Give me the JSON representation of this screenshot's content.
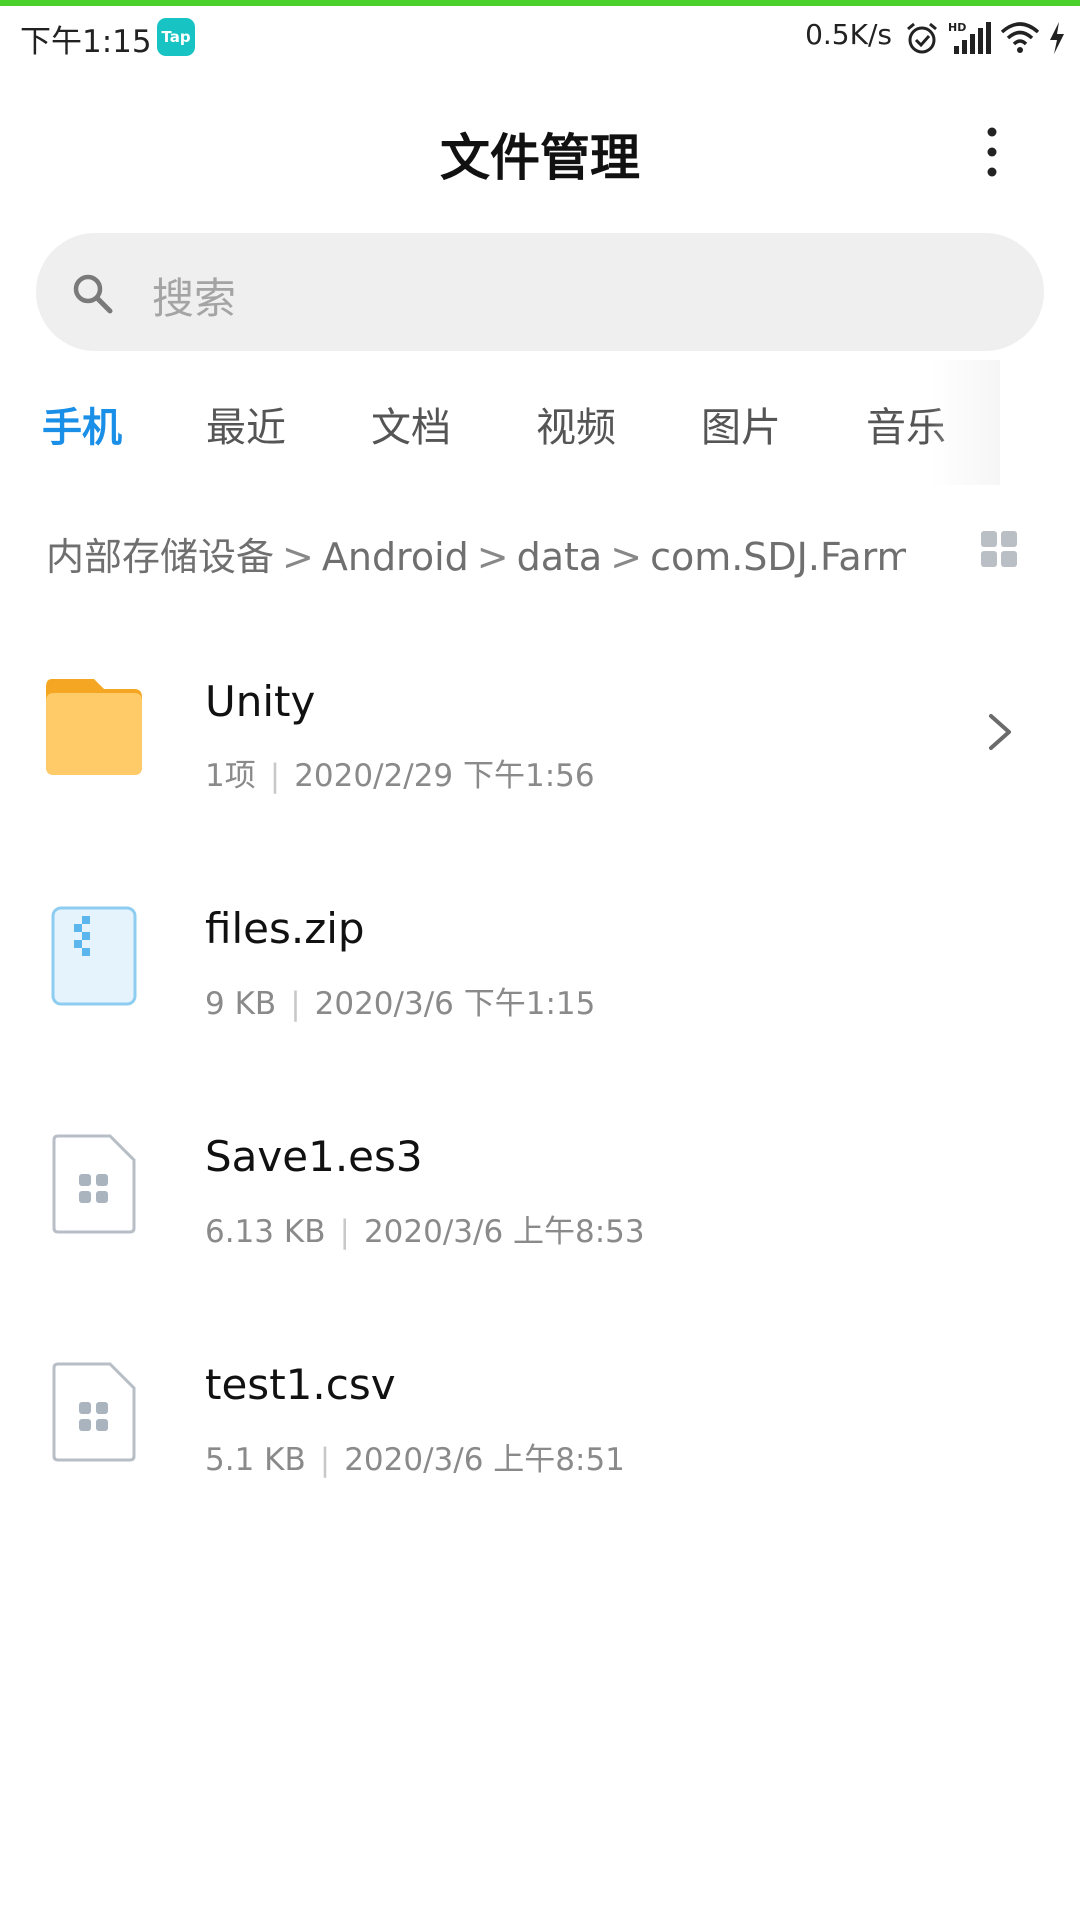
{
  "status_bar": {
    "time": "下午1:15",
    "app_badge": "Tap",
    "network_speed": "0.5K/s",
    "icons": [
      "alarm-icon",
      "hd-signal-icon",
      "wifi-icon",
      "charging-icon"
    ]
  },
  "header": {
    "title": "文件管理",
    "more_icon": "more-vertical-icon"
  },
  "search": {
    "placeholder": "搜索",
    "icon": "search-icon"
  },
  "tabs": [
    {
      "label": "手机",
      "active": true
    },
    {
      "label": "最近",
      "active": false
    },
    {
      "label": "文档",
      "active": false
    },
    {
      "label": "视频",
      "active": false
    },
    {
      "label": "图片",
      "active": false
    },
    {
      "label": "音乐",
      "active": false
    }
  ],
  "breadcrumb": [
    "内部存储设备",
    "Android",
    "data",
    "com.SDJ.Farm"
  ],
  "view_toggle_icon": "grid-view-icon",
  "files": [
    {
      "name": "Unity",
      "size": "1项",
      "date": "2020/2/29 下午1:56",
      "type": "folder",
      "icon": "folder-icon"
    },
    {
      "name": "files.zip",
      "size": "9 KB",
      "date": "2020/3/6 下午1:15",
      "type": "zip",
      "icon": "zip-file-icon"
    },
    {
      "name": "Save1.es3",
      "size": "6.13 KB",
      "date": "2020/3/6 上午8:53",
      "type": "file",
      "icon": "generic-file-icon"
    },
    {
      "name": "test1.csv",
      "size": "5.1 KB",
      "date": "2020/3/6 上午8:51",
      "type": "file",
      "icon": "generic-file-icon"
    }
  ],
  "colors": {
    "accent": "#1a8fe8",
    "folder": "#ffca68",
    "folder_tab": "#f5a623",
    "top_line": "#4cd12c",
    "search_bg": "#efefef"
  }
}
